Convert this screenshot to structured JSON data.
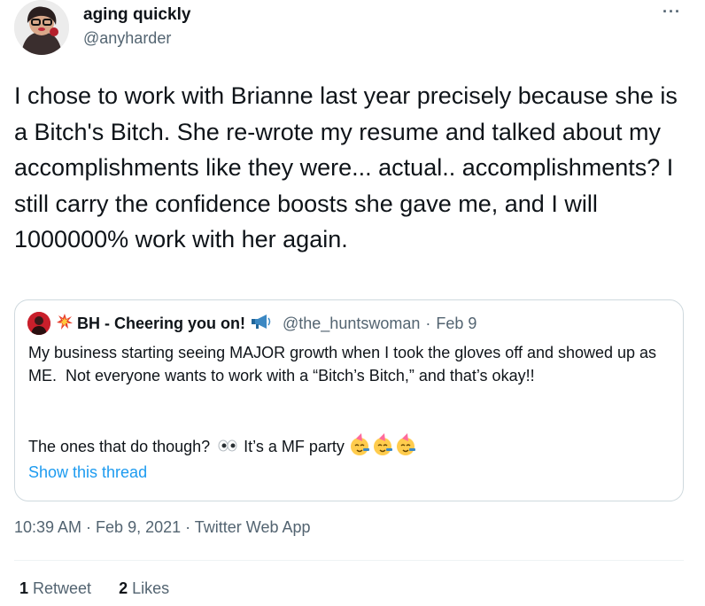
{
  "tweet": {
    "author": {
      "display_name": "aging quickly",
      "handle": "@anyharder",
      "avatar_icon": "profile-photo"
    },
    "more_label": "···",
    "text": "I chose to work with Brianne last year precisely because she is a Bitch's Bitch. She re-wrote my resume and talked about my accomplishments like they were... actual.. accomplishments? I still carry the confidence boosts she gave me, and I will 1000000% work with her again.",
    "timestamp": "10:39 AM · Feb 9, 2021 · Twitter Web App",
    "stats": {
      "retweets_count": "1",
      "retweets_label": " Retweet",
      "likes_count": "2",
      "likes_label": " Likes"
    }
  },
  "quote": {
    "name": "BH - Cheering you on!",
    "name_prefix_icon": "collision-icon",
    "name_suffix_icon": "megaphone-icon",
    "handle": "@the_huntswoman",
    "separator": "·",
    "date": "Feb 9",
    "body": "My business starting seeing MAJOR growth when I took the gloves off and showed up as ME.  Not everyone wants to work with a “Bitch’s Bitch,” and that’s okay!!",
    "line2_part1": "The ones that do though?",
    "line2_part2": "It’s a MF party",
    "show_thread_label": "Show this thread"
  },
  "colors": {
    "text": "#0f1419",
    "secondary": "#536471",
    "link": "#1d9bf0",
    "border": "#cfd9de"
  }
}
